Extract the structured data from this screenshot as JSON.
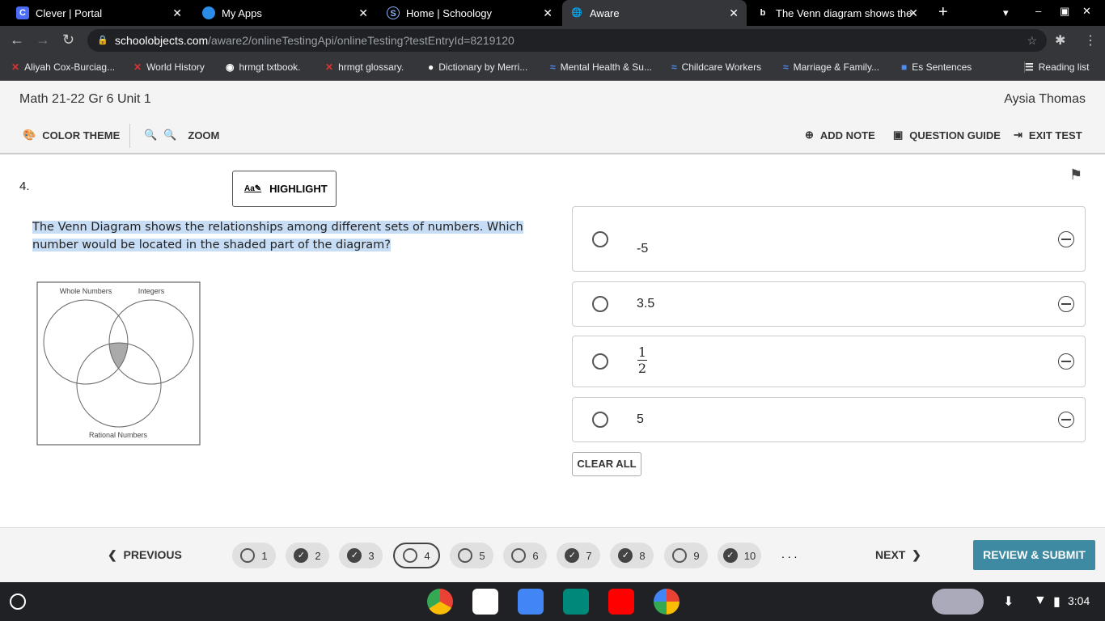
{
  "browser": {
    "tabs": [
      {
        "title": "Clever | Portal"
      },
      {
        "title": "My Apps"
      },
      {
        "title": "Home | Schoology"
      },
      {
        "title": "Aware"
      },
      {
        "title": "The Venn diagram shows the"
      }
    ],
    "url_domain": "schoolobjects.com",
    "url_path": "/aware2/onlineTestingApi/onlineTesting?testEntryId=8219120",
    "bookmarks": [
      "Aliyah Cox-Burciag...",
      "World History",
      "hrmgt txtbook.",
      "hrmgt glossary.",
      "Dictionary by Merri...",
      "Mental Health & Su...",
      "Childcare Workers",
      "Marriage & Family...",
      "Es Sentences"
    ],
    "reading_list": "Reading list"
  },
  "header": {
    "test_title": "Math 21-22 Gr 6 Unit 1",
    "student": "Aysia Thomas"
  },
  "toolbar": {
    "color_theme": "COLOR THEME",
    "zoom": "ZOOM",
    "add_note": "ADD NOTE",
    "question_guide": "QUESTION GUIDE",
    "exit_test": "EXIT TEST"
  },
  "question": {
    "number": "4.",
    "highlight": "HIGHLIGHT",
    "text": "The Venn Diagram shows the relationships among different sets of numbers. Which number would be located in the shaded part of the diagram?",
    "venn": {
      "a": "Whole Numbers",
      "b": "Integers",
      "c": "Rational Numbers"
    }
  },
  "answers": [
    {
      "text": "-5"
    },
    {
      "text": "3.5"
    },
    {
      "num": "1",
      "den": "2"
    },
    {
      "text": "5"
    }
  ],
  "clear_all": "CLEAR ALL",
  "footer": {
    "previous": "PREVIOUS",
    "next": "NEXT",
    "ellipsis": ". . .",
    "review": "REVIEW & SUBMIT",
    "questions": [
      {
        "n": "1",
        "done": false
      },
      {
        "n": "2",
        "done": true
      },
      {
        "n": "3",
        "done": true
      },
      {
        "n": "4",
        "done": false
      },
      {
        "n": "5",
        "done": false
      },
      {
        "n": "6",
        "done": false
      },
      {
        "n": "7",
        "done": true
      },
      {
        "n": "8",
        "done": true
      },
      {
        "n": "9",
        "done": false
      },
      {
        "n": "10",
        "done": true
      }
    ]
  },
  "shelf": {
    "time": "3:04"
  }
}
